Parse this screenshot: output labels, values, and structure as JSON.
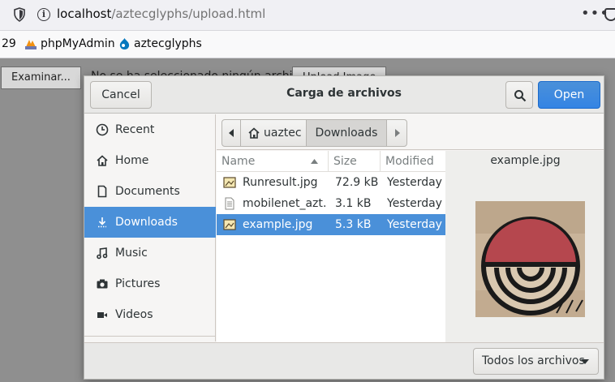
{
  "browser": {
    "url_host": "localhost",
    "url_path": "/aztecglyphs/upload.html",
    "bookmarks": {
      "leading_number": "29",
      "items": [
        {
          "label": "phpMyAdmin",
          "icon": "phpmyadmin-icon"
        },
        {
          "label": "aztecglyphs",
          "icon": "drupal-icon"
        }
      ]
    }
  },
  "page": {
    "browse_button": "Examinar...",
    "no_file_text": "No se ha seleccionado ningún archivo.",
    "upload_button": "Upload Image"
  },
  "dialog": {
    "title": "Carga de archivos",
    "cancel_label": "Cancel",
    "open_label": "Open",
    "sidebar": [
      {
        "label": "Recent",
        "icon": "clock-icon"
      },
      {
        "label": "Home",
        "icon": "home-icon"
      },
      {
        "label": "Documents",
        "icon": "document-icon"
      },
      {
        "label": "Downloads",
        "icon": "download-icon",
        "active": true
      },
      {
        "label": "Music",
        "icon": "music-icon"
      },
      {
        "label": "Pictures",
        "icon": "camera-icon"
      },
      {
        "label": "Videos",
        "icon": "video-icon"
      }
    ],
    "path": {
      "home": "uaztec",
      "current": "Downloads"
    },
    "columns": {
      "name": "Name",
      "size": "Size",
      "modified": "Modified"
    },
    "files": [
      {
        "name": "Runresult.jpg",
        "size": "72.9 kB",
        "modified": "Yesterday",
        "icon": "image-icon"
      },
      {
        "name": "mobilenet_azt…",
        "size": "3.1 kB",
        "modified": "Yesterday",
        "icon": "text-file-icon"
      },
      {
        "name": "example.jpg",
        "size": "5.3 kB",
        "modified": "Yesterday",
        "icon": "image-icon",
        "selected": true
      }
    ],
    "preview_name": "example.jpg",
    "filter_label": "Todos los archivos"
  },
  "colors": {
    "accent": "#4a90d9",
    "glyph_red": "#b5474e"
  }
}
